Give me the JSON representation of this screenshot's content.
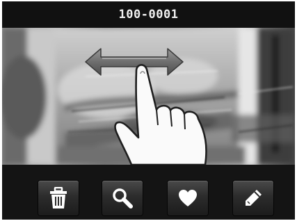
{
  "header": {
    "title": "100-0001"
  },
  "viewer": {
    "gesture_hint": "swipe-left-right",
    "icons": [
      "double-arrow-icon",
      "pointing-hand-icon"
    ]
  },
  "toolbar": {
    "buttons": [
      {
        "icon": "trash-icon"
      },
      {
        "icon": "magnifier-icon"
      },
      {
        "icon": "heart-icon"
      },
      {
        "icon": "pencil-icon"
      }
    ]
  }
}
